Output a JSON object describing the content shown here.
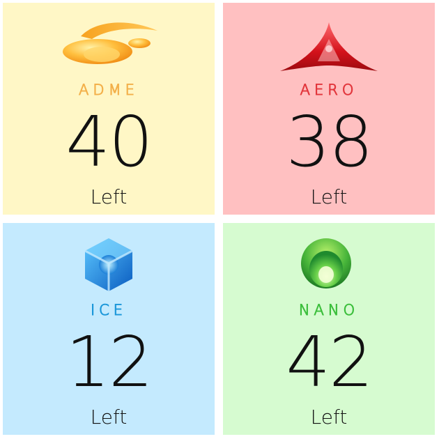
{
  "tiles": [
    {
      "brand": "ADME",
      "count": "40",
      "label": "Left",
      "bg": "#fff7c6",
      "brand_color": "#f3b04a",
      "logo_icon": "adme-swoosh-logo-icon"
    },
    {
      "brand": "AERO",
      "count": "38",
      "label": "Left",
      "bg": "#ffc0c1",
      "brand_color": "#e2363c",
      "logo_icon": "aero-triangle-logo-icon"
    },
    {
      "brand": "ICE",
      "count": "12",
      "label": "Left",
      "bg": "#c4eafe",
      "brand_color": "#1b97d9",
      "logo_icon": "ice-cube-logo-icon"
    },
    {
      "brand": "NANO",
      "count": "42",
      "label": "Left",
      "bg": "#d6fbd0",
      "brand_color": "#3cbf3c",
      "logo_icon": "nano-sphere-logo-icon"
    }
  ]
}
